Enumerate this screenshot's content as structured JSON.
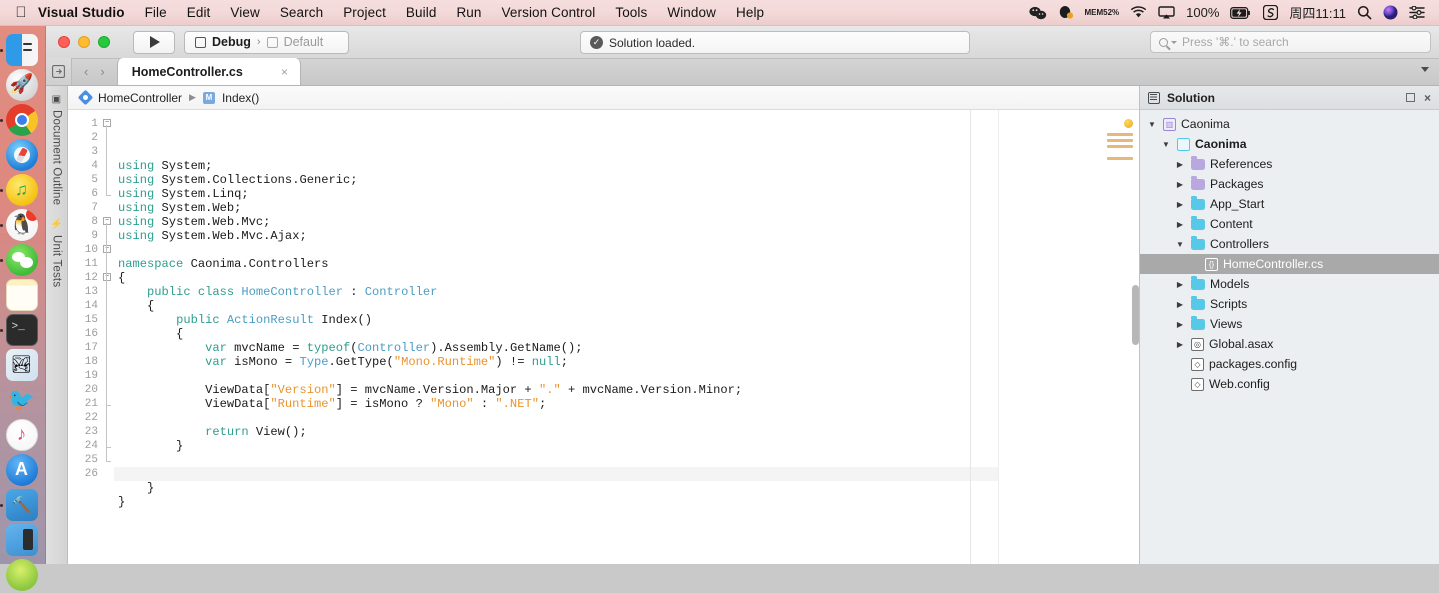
{
  "menubar": {
    "apple": "",
    "app_name": "Visual Studio",
    "items": [
      "File",
      "Edit",
      "View",
      "Search",
      "Project",
      "Build",
      "Run",
      "Version Control",
      "Tools",
      "Window",
      "Help"
    ],
    "status": {
      "wechat": "wechat-icon",
      "qq": "qq-icon",
      "mem_label": "MEM",
      "mem_value": "52%",
      "wifi": "wifi-icon",
      "airplay": "airplay-icon",
      "battery_percent": "100%",
      "battery": "battery-charging-icon",
      "sogou": "S",
      "clock": "周四11:11",
      "search": "spotlight-icon",
      "siri": "siri-icon",
      "control_center": "control-center-icon"
    }
  },
  "dock": {
    "items": [
      {
        "name": "finder",
        "running": true
      },
      {
        "name": "launchpad",
        "running": false
      },
      {
        "name": "chrome",
        "running": true
      },
      {
        "name": "safari",
        "running": false
      },
      {
        "name": "qq-music",
        "running": true
      },
      {
        "name": "qq",
        "running": true,
        "badge": ""
      },
      {
        "name": "wechat",
        "running": true
      },
      {
        "name": "notes",
        "running": false
      },
      {
        "name": "terminal",
        "running": true
      },
      {
        "name": "photos",
        "running": false
      },
      {
        "name": "twitter",
        "running": false
      },
      {
        "name": "itunes",
        "running": false
      },
      {
        "name": "app-store",
        "running": false
      },
      {
        "name": "xcode",
        "running": true
      },
      {
        "name": "simulator",
        "running": false
      },
      {
        "name": "green-app",
        "running": false
      }
    ]
  },
  "toolbar": {
    "run_button": "run-icon",
    "configuration": "Debug",
    "separator": "›",
    "device": "Default",
    "status_message": "Solution loaded.",
    "status_icon": "✓",
    "search_placeholder": "Press '⌘.' to search"
  },
  "tabbar": {
    "back": "‹",
    "forward": "›",
    "active_tab": "HomeController.cs",
    "close": "×"
  },
  "vertical_tabs": [
    {
      "label": "Document Outline",
      "glyph": "▣"
    },
    {
      "label": "Unit Tests",
      "glyph": "⚡"
    }
  ],
  "breadcrumb": {
    "class": "HomeController",
    "arrow": "▶",
    "member": "Index()",
    "member_badge": "M"
  },
  "editor": {
    "first_line": 1,
    "last_line": 26,
    "current_line": 23,
    "lines": [
      {
        "n": 1,
        "tokens": [
          [
            "kw",
            "using"
          ],
          [
            "ident",
            " System;"
          ]
        ]
      },
      {
        "n": 2,
        "tokens": [
          [
            "kw",
            "using"
          ],
          [
            "ident",
            " System.Collections.Generic;"
          ]
        ]
      },
      {
        "n": 3,
        "tokens": [
          [
            "kw",
            "using"
          ],
          [
            "ident",
            " System.Linq;"
          ]
        ]
      },
      {
        "n": 4,
        "tokens": [
          [
            "kw",
            "using"
          ],
          [
            "ident",
            " System.Web;"
          ]
        ]
      },
      {
        "n": 5,
        "tokens": [
          [
            "kw",
            "using"
          ],
          [
            "ident",
            " System.Web.Mvc;"
          ]
        ]
      },
      {
        "n": 6,
        "tokens": [
          [
            "kw",
            "using"
          ],
          [
            "ident",
            " System.Web.Mvc.Ajax;"
          ]
        ]
      },
      {
        "n": 7,
        "tokens": []
      },
      {
        "n": 8,
        "tokens": [
          [
            "kw",
            "namespace"
          ],
          [
            "ident",
            " Caonima.Controllers"
          ]
        ]
      },
      {
        "n": 9,
        "tokens": [
          [
            "ident",
            "{"
          ]
        ]
      },
      {
        "n": 10,
        "tokens": [
          [
            "ident",
            "    "
          ],
          [
            "kw",
            "public class"
          ],
          [
            "ident",
            " "
          ],
          [
            "typ",
            "HomeController"
          ],
          [
            "ident",
            " : "
          ],
          [
            "typ",
            "Controller"
          ]
        ]
      },
      {
        "n": 11,
        "tokens": [
          [
            "ident",
            "    {"
          ]
        ]
      },
      {
        "n": 12,
        "tokens": [
          [
            "ident",
            "        "
          ],
          [
            "kw",
            "public"
          ],
          [
            "ident",
            " "
          ],
          [
            "typ",
            "ActionResult"
          ],
          [
            "ident",
            " Index()"
          ]
        ]
      },
      {
        "n": 13,
        "tokens": [
          [
            "ident",
            "        {"
          ]
        ]
      },
      {
        "n": 14,
        "tokens": [
          [
            "ident",
            "            "
          ],
          [
            "kw",
            "var"
          ],
          [
            "ident",
            " mvcName = "
          ],
          [
            "kw",
            "typeof"
          ],
          [
            "ident",
            "("
          ],
          [
            "typ",
            "Controller"
          ],
          [
            "ident",
            ").Assembly.GetName();"
          ]
        ]
      },
      {
        "n": 15,
        "tokens": [
          [
            "ident",
            "            "
          ],
          [
            "kw",
            "var"
          ],
          [
            "ident",
            " isMono = "
          ],
          [
            "typ",
            "Type"
          ],
          [
            "ident",
            ".GetType("
          ],
          [
            "str",
            "\"Mono.Runtime\""
          ],
          [
            "ident",
            ") != "
          ],
          [
            "kw",
            "null"
          ],
          [
            "ident",
            ";"
          ]
        ]
      },
      {
        "n": 16,
        "tokens": []
      },
      {
        "n": 17,
        "tokens": [
          [
            "ident",
            "            ViewData["
          ],
          [
            "str",
            "\"Version\""
          ],
          [
            "ident",
            "] = mvcName.Version.Major + "
          ],
          [
            "str",
            "\".\""
          ],
          [
            "ident",
            " + mvcName.Version.Minor;"
          ]
        ]
      },
      {
        "n": 18,
        "tokens": [
          [
            "ident",
            "            ViewData["
          ],
          [
            "str",
            "\"Runtime\""
          ],
          [
            "ident",
            "] = isMono ? "
          ],
          [
            "str",
            "\"Mono\""
          ],
          [
            "ident",
            " : "
          ],
          [
            "str",
            "\".NET\""
          ],
          [
            "ident",
            ";"
          ]
        ]
      },
      {
        "n": 19,
        "tokens": []
      },
      {
        "n": 20,
        "tokens": [
          [
            "ident",
            "            "
          ],
          [
            "kw",
            "return"
          ],
          [
            "ident",
            " View();"
          ]
        ]
      },
      {
        "n": 21,
        "tokens": [
          [
            "ident",
            "        }"
          ]
        ]
      },
      {
        "n": 22,
        "tokens": []
      },
      {
        "n": 23,
        "tokens": []
      },
      {
        "n": 24,
        "tokens": [
          [
            "ident",
            "    }"
          ]
        ]
      },
      {
        "n": 25,
        "tokens": [
          [
            "ident",
            "}"
          ]
        ]
      },
      {
        "n": 26,
        "tokens": []
      }
    ],
    "colors": {
      "keyword": "#2e9e8f",
      "type": "#4d9dc4",
      "string": "#e8942f",
      "text": "#1b1b1b",
      "background": "#ffffff",
      "current_line": "#f4f4f4"
    }
  },
  "solution": {
    "title": "Solution",
    "maximize": "maximize-icon",
    "close": "×",
    "tree": [
      {
        "label": "Caonima",
        "depth": 0,
        "twisty": "open",
        "icon": "solution",
        "bold": false
      },
      {
        "label": "Caonima",
        "depth": 1,
        "twisty": "open",
        "icon": "project",
        "bold": true
      },
      {
        "label": "References",
        "depth": 2,
        "twisty": "closed",
        "icon": "folder-purple",
        "bold": false
      },
      {
        "label": "Packages",
        "depth": 2,
        "twisty": "closed",
        "icon": "folder-purple",
        "bold": false
      },
      {
        "label": "App_Start",
        "depth": 2,
        "twisty": "closed",
        "icon": "folder-cyan",
        "bold": false
      },
      {
        "label": "Content",
        "depth": 2,
        "twisty": "closed",
        "icon": "folder-cyan",
        "bold": false
      },
      {
        "label": "Controllers",
        "depth": 2,
        "twisty": "open",
        "icon": "folder-cyan",
        "bold": false
      },
      {
        "label": "HomeController.cs",
        "depth": 3,
        "twisty": "none",
        "icon": "cs-file",
        "bold": false,
        "selected": true
      },
      {
        "label": "Models",
        "depth": 2,
        "twisty": "closed",
        "icon": "folder-cyan",
        "bold": false
      },
      {
        "label": "Scripts",
        "depth": 2,
        "twisty": "closed",
        "icon": "folder-cyan",
        "bold": false
      },
      {
        "label": "Views",
        "depth": 2,
        "twisty": "closed",
        "icon": "folder-cyan",
        "bold": false
      },
      {
        "label": "Global.asax",
        "depth": 2,
        "twisty": "closed",
        "icon": "asax-file",
        "bold": false
      },
      {
        "label": "packages.config",
        "depth": 2,
        "twisty": "none",
        "icon": "config-file",
        "bold": false
      },
      {
        "label": "Web.config",
        "depth": 2,
        "twisty": "none",
        "icon": "config-file",
        "bold": false
      }
    ]
  }
}
